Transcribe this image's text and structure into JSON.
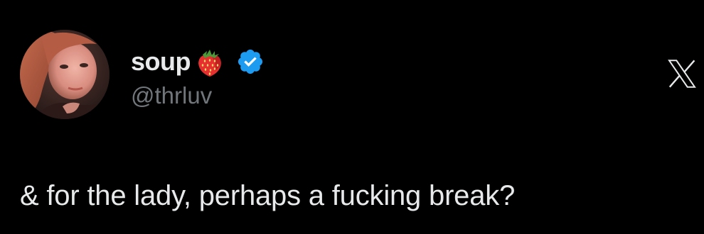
{
  "author": {
    "display_name": "soup",
    "handle": "@thrluv",
    "name_emoji": "strawberry-icon",
    "verified": true
  },
  "tweet": {
    "text": "& for the lady, perhaps a fucking break?"
  },
  "brand": {
    "logo": "x-logo-icon"
  },
  "colors": {
    "background": "#000000",
    "primary_text": "#e7e9ea",
    "secondary_text": "#71767b",
    "verified_badge": "#1d9bf0"
  }
}
